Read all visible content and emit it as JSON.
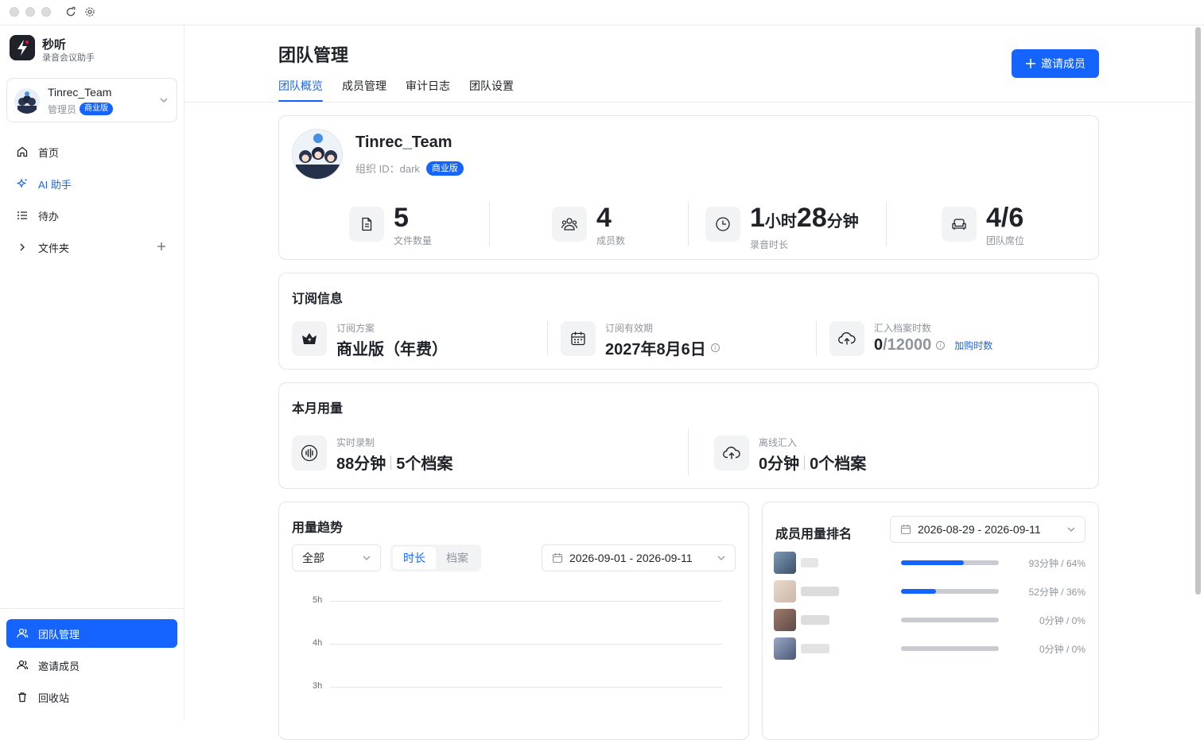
{
  "app": {
    "name": "秒听",
    "subtitle": "录音会议助手"
  },
  "team_switcher": {
    "name": "Tinrec_Team",
    "role": "管理员",
    "plan_badge": "商业版"
  },
  "sidebar": {
    "items": [
      {
        "label": "首页",
        "icon": "home-icon"
      },
      {
        "label": "AI 助手",
        "icon": "sparkle-icon"
      },
      {
        "label": "待办",
        "icon": "list-icon"
      },
      {
        "label": "文件夹",
        "icon": "folder-chevron-icon"
      }
    ],
    "bottom_items": [
      {
        "label": "团队管理",
        "icon": "team-icon",
        "active": true
      },
      {
        "label": "邀请成员",
        "icon": "invite-icon"
      },
      {
        "label": "回收站",
        "icon": "trash-icon"
      }
    ]
  },
  "header": {
    "title": "团队管理",
    "invite_button": "邀请成员",
    "tabs": [
      "团队概览",
      "成员管理",
      "审计日志",
      "团队设置"
    ]
  },
  "org": {
    "name": "Tinrec_Team",
    "id_label": "组织 ID：",
    "id": "dark",
    "badge": "商业版",
    "stats": [
      {
        "value": "5",
        "label": "文件数量",
        "icon": "file-icon"
      },
      {
        "value": "4",
        "label": "成员数",
        "icon": "members-icon"
      },
      {
        "value_h": "1",
        "unit_h": "小时",
        "value_m": "28",
        "unit_m": "分钟",
        "label": "录音时长",
        "icon": "clock-icon"
      },
      {
        "value": "4/6",
        "label": "团队席位",
        "icon": "sofa-icon"
      }
    ]
  },
  "subscription": {
    "title": "订阅信息",
    "plan_label": "订阅方案",
    "plan_value": "商业版（年费）",
    "expiry_label": "订阅有效期",
    "expiry_value": "2027年8月6日",
    "import_label": "汇入档案时数",
    "import_used": "0",
    "import_total": "/12000",
    "buy_link": "加购时数"
  },
  "usage": {
    "title": "本月用量",
    "realtime_label": "实时录制",
    "realtime_minutes": "88分钟",
    "realtime_files": "5个档案",
    "offline_label": "离线汇入",
    "offline_minutes": "0分钟",
    "offline_files": "0个档案"
  },
  "trend": {
    "title": "用量趋势",
    "filter": "全部",
    "seg_on": "时长",
    "seg_off": "档案",
    "date_range": "2026-09-01 - 2026-09-11"
  },
  "chart_data": {
    "type": "line",
    "title": "用量趋势",
    "ytick_labels": [
      "5h",
      "4h",
      "3h"
    ],
    "series": []
  },
  "ranking": {
    "title": "成员用量排名",
    "date_range": "2026-08-29 - 2026-09-11",
    "rows": [
      {
        "value": "93分钟 / 64%",
        "fraction": 0.64
      },
      {
        "value": "52分钟 / 36%",
        "fraction": 0.36
      },
      {
        "value": "0分钟 / 0%",
        "fraction": 0
      },
      {
        "value": "0分钟 / 0%",
        "fraction": 0
      }
    ]
  },
  "colors": {
    "accent": "#1664ff",
    "text": "#1f2329",
    "muted": "#8f959e"
  }
}
